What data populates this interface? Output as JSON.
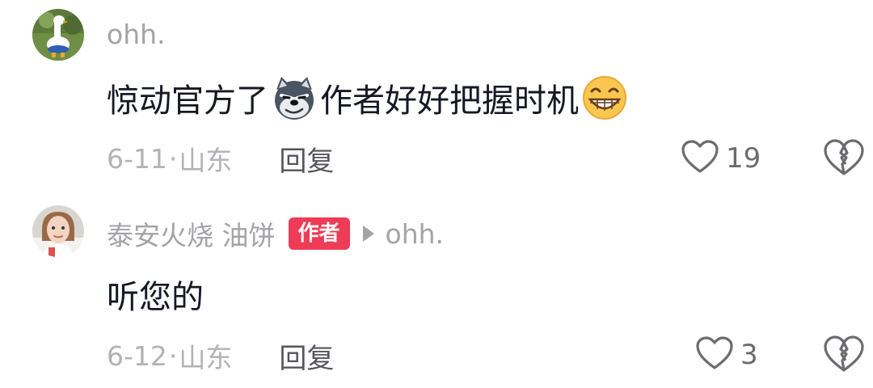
{
  "comments": [
    {
      "username": "ohh.",
      "content_part1": "惊动官方了",
      "emoji1": "wolf-sly-emoji",
      "content_part2": "作者好好把握时机",
      "emoji2": "grin-emoji",
      "date": "6-11",
      "separator": "·",
      "location": "山东",
      "reply_label": "回复",
      "like_count": "19"
    },
    {
      "username": "泰安火烧 油饼",
      "badge": "作者",
      "reply_to": "ohh.",
      "content": "听您的",
      "date": "6-12",
      "separator": "·",
      "location": "山东",
      "reply_label": "回复",
      "like_count": "3"
    }
  ],
  "icons": {
    "like": "heart-outline-icon",
    "dislike": "broken-heart-icon"
  },
  "colors": {
    "author_badge": "#ee3b56",
    "secondary_text": "#a3a3a8",
    "primary_text": "#161823"
  }
}
